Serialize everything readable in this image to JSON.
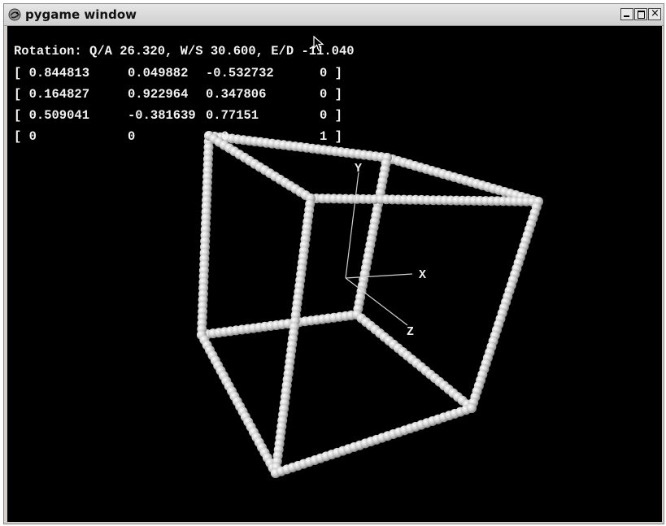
{
  "window": {
    "title": "pygame window",
    "icon": "pygame-snake-icon",
    "controls": [
      "minimize-icon",
      "maximize-icon",
      "close-icon"
    ]
  },
  "hud": {
    "rotation_text": "Rotation: Q/A 26.320, W/S 30.600, E/D -11.040",
    "matrix": [
      [
        "[ 0.844813",
        "0.049882",
        "-0.532732",
        "0 ]"
      ],
      [
        "[ 0.164827",
        "0.922964",
        "0.347806",
        "0 ]"
      ],
      [
        "[ 0.509041",
        "-0.381639",
        "0.77151",
        "0 ]"
      ],
      [
        "[ 0",
        "0",
        "0",
        "1 ]"
      ]
    ]
  },
  "axes": {
    "x_label": "X",
    "y_label": "Y",
    "z_label": "Z"
  },
  "colors": {
    "background": "#000000",
    "beads": "#d9d9d9",
    "text": "#f2f2f2"
  }
}
